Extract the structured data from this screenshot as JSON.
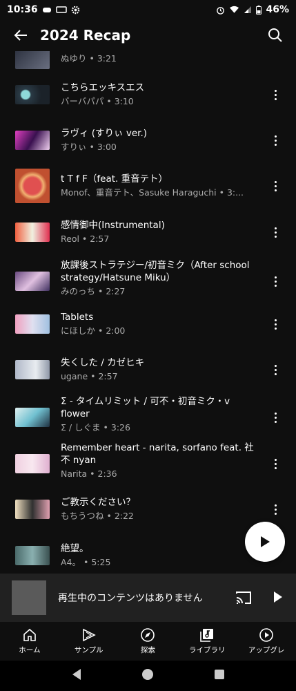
{
  "status_bar": {
    "time": "10:36",
    "battery": "46%"
  },
  "header": {
    "title": "2024 Recap"
  },
  "tracks": [
    {
      "title": "",
      "subtitle": "ぬゆり • 3:21"
    },
    {
      "title": "こちらエッキスエス",
      "subtitle": "バーバパパ • 3:10"
    },
    {
      "title": "ラヴィ (すりぃ ver.)",
      "subtitle": "すりぃ • 3:00"
    },
    {
      "title": "t T f F（feat. 重音テト）",
      "subtitle": "Monof、重音テト、Sasuke Haraguchi • 3:..."
    },
    {
      "title": "感情御中(Instrumental)",
      "subtitle": "Reol • 2:57"
    },
    {
      "title": "放課後ストラテジー/初音ミク（After school strategy/Hatsune Miku）",
      "subtitle": "みのっち • 2:27"
    },
    {
      "title": "Tablets",
      "subtitle": "にほしか • 2:00"
    },
    {
      "title": "失くした / カゼヒキ",
      "subtitle": "ugane • 2:57"
    },
    {
      "title": "Σ - タイムリミット / 可不・初音ミク・v flower",
      "subtitle": "Σ / しぐま • 3:26"
    },
    {
      "title": "Remember heart - narita, sorfano feat. 社不 nyan",
      "subtitle": "Narita • 2:36"
    },
    {
      "title": "ご教示ください？",
      "subtitle": "もちうつね • 2:22"
    },
    {
      "title": "絶望。",
      "subtitle": "A4。 • 5:25"
    }
  ],
  "mini_player": {
    "text": "再生中のコンテンツはありません"
  },
  "bottom_nav": [
    {
      "label": "ホーム",
      "icon": "home-icon"
    },
    {
      "label": "サンプル",
      "icon": "samples-icon"
    },
    {
      "label": "探索",
      "icon": "explore-icon"
    },
    {
      "label": "ライブラリ",
      "icon": "library-icon"
    },
    {
      "label": "アップグレ",
      "icon": "upgrade-icon"
    }
  ],
  "colors": {
    "background": "#0f0f0f",
    "mini_player": "#212121",
    "secondary_text": "#aaaaaa"
  }
}
